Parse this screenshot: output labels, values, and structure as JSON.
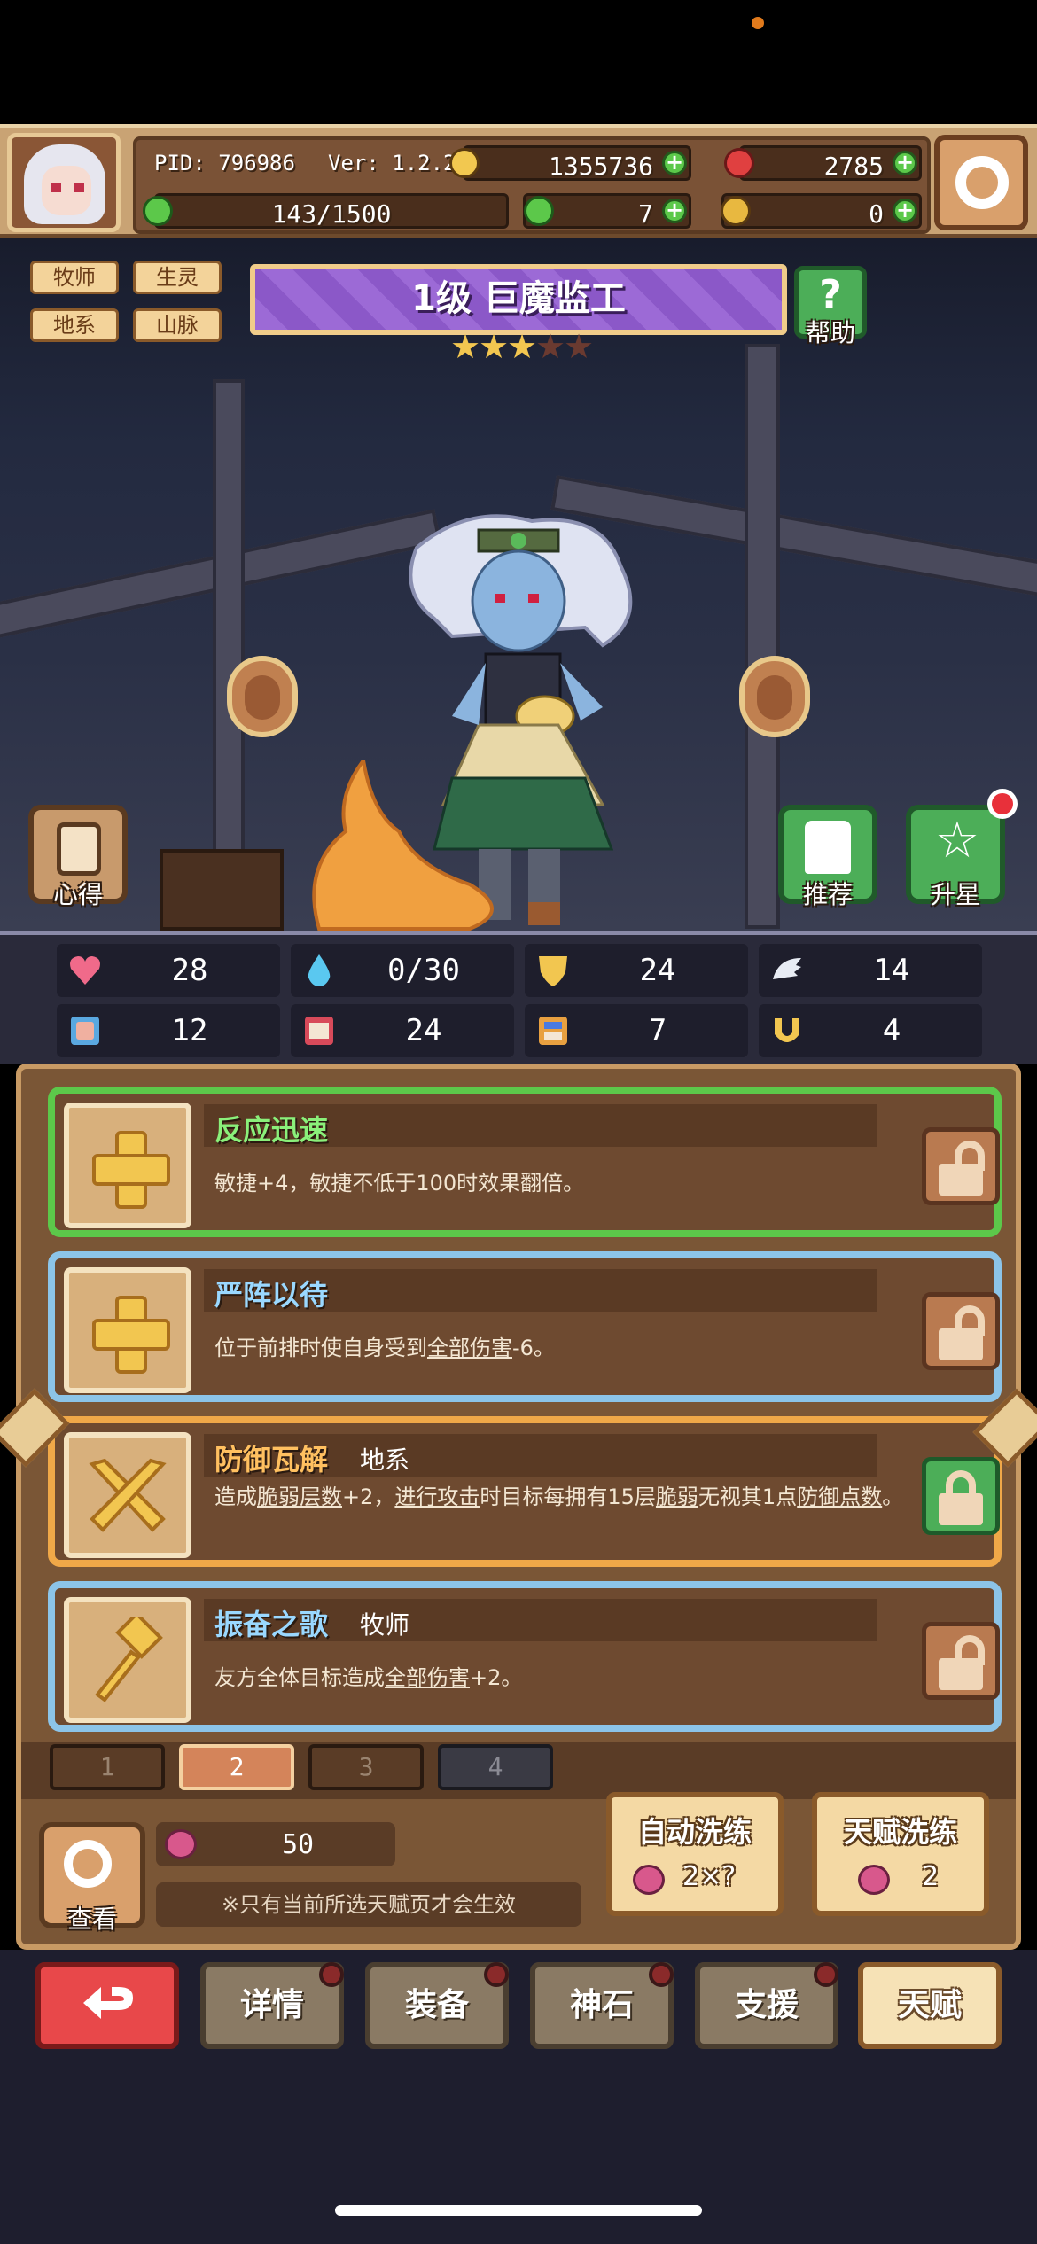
{
  "topbar": {
    "pid": "PID: 796986",
    "version": "Ver: 1.2.2.5",
    "gold": "1355736",
    "red_gems": "2785",
    "exp": "143/1500",
    "clover": "7",
    "keys": "0"
  },
  "hero": {
    "tags": [
      "牧师",
      "生灵",
      "地系",
      "山脉"
    ],
    "title": "1级 巨魔监工",
    "stars_filled": 3,
    "stars_total": 5,
    "help_label": "帮助",
    "notes_label": "心得",
    "recommend_label": "推荐",
    "star_up_label": "升星"
  },
  "stats": [
    {
      "icon": "heart-icon",
      "value": "28"
    },
    {
      "icon": "water-drop-icon",
      "value": "0/30"
    },
    {
      "icon": "shield-icon",
      "value": "24"
    },
    {
      "icon": "wing-icon",
      "value": "14"
    },
    {
      "icon": "fist-icon",
      "value": "12"
    },
    {
      "icon": "book-icon",
      "value": "24"
    },
    {
      "icon": "stack-icon",
      "value": "7"
    },
    {
      "icon": "horseshoe-icon",
      "value": "4"
    }
  ],
  "talents": [
    {
      "name": "反应迅速",
      "tag": "",
      "desc": "敏捷+4，敏捷不低于100时效果翻倍。",
      "frame": "green",
      "locked": false
    },
    {
      "name": "严阵以待",
      "tag": "",
      "desc_pre": "位于前排时使自身受到",
      "desc_link": "全部伤害",
      "desc_post": "-6。",
      "frame": "blue",
      "locked": false
    },
    {
      "name": "防御瓦解",
      "tag": "地系",
      "desc_parts": [
        "造成",
        "脆弱层数",
        "+2，",
        "进行攻击",
        "时目标每拥有15层",
        "脆弱",
        "无视其1点",
        "防御点数",
        "。"
      ],
      "frame": "orange",
      "locked": true
    },
    {
      "name": "振奋之歌",
      "tag": "牧师",
      "desc_pre": "友方全体目标造成",
      "desc_link": "全部伤害",
      "desc_post": "+2。",
      "frame": "blue",
      "locked": false
    }
  ],
  "pages": [
    "1",
    "2",
    "3",
    "4"
  ],
  "active_page": "2",
  "footer": {
    "view_label": "查看",
    "plum_count": "50",
    "notice": "※只有当前所选天赋页才会生效",
    "auto_wash": "自动洗练",
    "auto_wash_cost": "2×?",
    "talent_wash": "天赋洗练",
    "talent_wash_cost": "2"
  },
  "nav": [
    "详情",
    "装备",
    "神石",
    "支援",
    "天赋"
  ],
  "active_nav": "天赋",
  "colors": {
    "green_frame": "#5cc84a",
    "blue_frame": "#8cc4e8",
    "orange_frame": "#f0a848",
    "name_green": "#8af07a",
    "name_blue": "#9ad8ff",
    "name_orange": "#ffc060"
  }
}
